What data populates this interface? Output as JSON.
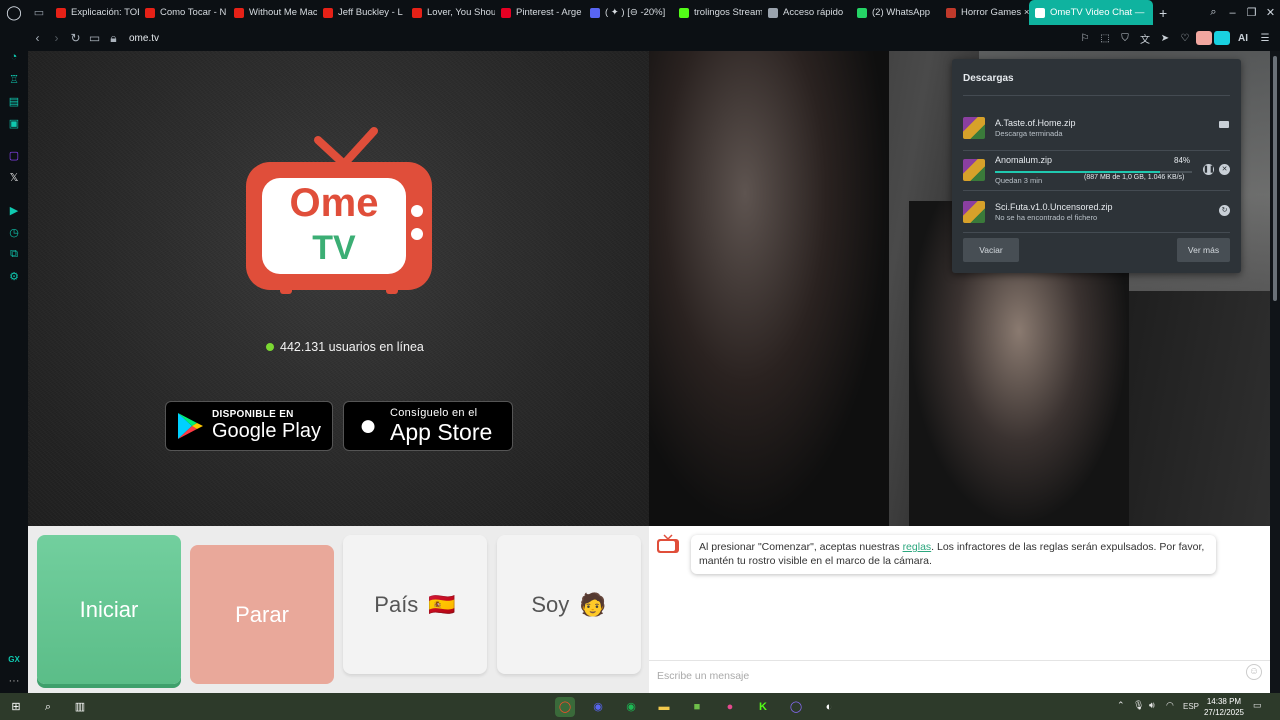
{
  "browser": {
    "tabs": [
      {
        "label": "Explicación: TOE",
        "color": "#e62117"
      },
      {
        "label": "Como Tocar - N",
        "color": "#e62117"
      },
      {
        "label": "Without Me Mac",
        "color": "#e62117"
      },
      {
        "label": "Jeff Buckley - L",
        "color": "#e62117"
      },
      {
        "label": "Lover, You Shou",
        "color": "#e62117"
      },
      {
        "label": "Pinterest - Arge",
        "color": "#e60023"
      },
      {
        "label": "( ✦ ) [⊖ -20%]",
        "color": "#5865f2"
      },
      {
        "label": "trolingos Stream",
        "color": "#53fc18"
      },
      {
        "label": "Acceso rápido",
        "color": "#9aa3ad"
      },
      {
        "label": "(2) WhatsApp",
        "color": "#25d366"
      },
      {
        "label": "Horror Games ×",
        "color": "#c0392b"
      },
      {
        "label": "OmeTV Video Chat —",
        "color": "#0fb39f"
      }
    ],
    "url": "ome.tv",
    "ai_label": "AI"
  },
  "ometv": {
    "logo_top": "Ome",
    "logo_bottom": "TV",
    "online_text": "442.131 usuarios en línea",
    "online_color": "#7bd832",
    "google_small": "DISPONIBLE EN",
    "google_big": "Google Play",
    "apple_small": "Consíguelo en el",
    "apple_big": "App Store",
    "buttons": {
      "start": "Iniciar",
      "stop": "Parar",
      "country": "País",
      "country_flag": "🇪🇸",
      "me": "Soy",
      "me_emoji": "🧑"
    },
    "chat": {
      "notice_pre": "Al presionar \"Comenzar\", aceptas nuestras ",
      "notice_link": "reglas",
      "notice_post": ". Los infractores de las reglas serán expulsados. Por favor, mantén tu rostro visible en el marco de la cámara.",
      "placeholder": "Escribe un mensaje"
    }
  },
  "downloads": {
    "title": "Descargas",
    "items": [
      {
        "name": "A.Taste.of.Home.zip",
        "status": "Descarga terminada"
      },
      {
        "name": "Anomalum.zip",
        "status": "Quedan 3 min",
        "percent": "84%",
        "progress": 0.84,
        "detail": "(887 MB de 1,0 GB, 1.046 KB/s)"
      },
      {
        "name": "Sci.Futa.v1.0.Uncensored.zip",
        "status": "No se ha encontrado el fichero"
      }
    ],
    "clear_label": "Vaciar",
    "more_label": "Ver más"
  },
  "taskbar": {
    "lang": "ESP",
    "time": "14:38 PM",
    "date": "27/12/2025"
  }
}
